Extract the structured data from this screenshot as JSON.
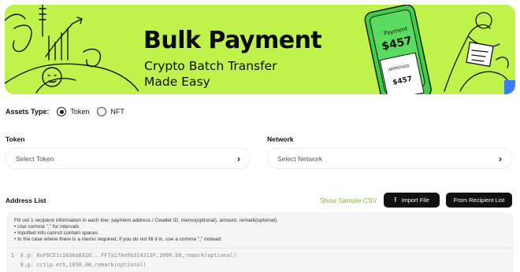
{
  "banner": {
    "title": "Bulk Payment",
    "subtitle_line1": "Crypto Batch Transfer",
    "subtitle_line2": "Made Easy",
    "phone_label": "Payment",
    "phone_amount": "$457",
    "receipt_status": "APPROVED",
    "receipt_amount": "$457",
    "background_color": "#bff24a"
  },
  "assets": {
    "label": "Assets Type:",
    "options": [
      {
        "label": "Token",
        "selected": true
      },
      {
        "label": "NFT",
        "selected": false
      }
    ]
  },
  "token": {
    "label": "Token",
    "placeholder": "Select Token"
  },
  "network": {
    "label": "Network",
    "placeholder": "Select Network"
  },
  "address_list": {
    "label": "Address List",
    "sample_link": "Show Sample CSV",
    "import_button": "Import File",
    "recipient_button": "From Recipient List",
    "instructions": [
      "Fill out 1 recipient information in each line: payment address / Cwallet ID, memo(optional), amount, remark(optional).",
      "• Use comma \",\" for intervals",
      "• Inputted info cannot contain spaces",
      "• In the case where there is a memo required, if you do not fill it in, use a comma \",\" instead."
    ],
    "line_number": "1",
    "example_1": "E.g: 0xF6CE1c2A36a8310...FF7a17Ae9b314313F,1000.00,remark(optional)",
    "example_2": "E.g: cctip.eth,1030.00,remark(optional)"
  }
}
